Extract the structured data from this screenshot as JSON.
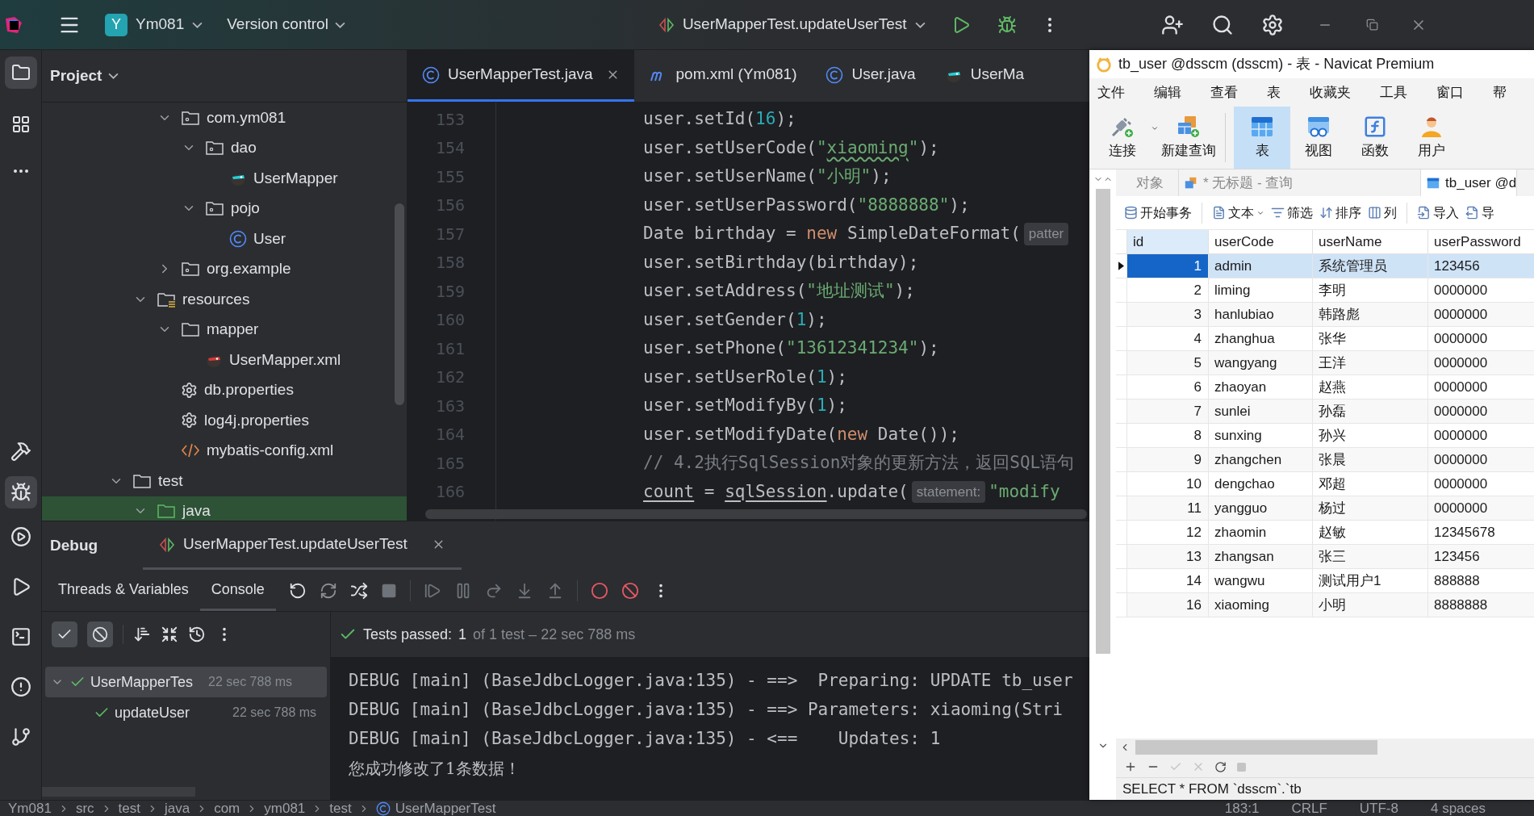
{
  "ide": {
    "topbar": {
      "badge": "Y",
      "project": "Ym081",
      "vcs": "Version control",
      "run_config": "UserMapperTest.updateUserTest"
    },
    "project_panel": {
      "title": "Project",
      "tree": [
        {
          "children": [
            {
              "children": [
                {
                  "label": "com.ym081",
                  "kind": "package",
                  "expanded": true,
                  "selected": false,
                  "children": [
                    {
                      "label": "dao",
                      "kind": "package",
                      "expanded": true,
                      "selected": false,
                      "children": [
                        {
                          "label": "UserMapper",
                          "kind": "mapper",
                          "selected": false
                        }
                      ]
                    },
                    {
                      "label": "pojo",
                      "kind": "package",
                      "expanded": true,
                      "selected": false,
                      "children": [
                        {
                          "label": "User",
                          "kind": "class",
                          "selected": false
                        }
                      ]
                    }
                  ]
                },
                {
                  "label": "org.example",
                  "kind": "package",
                  "expanded": false,
                  "selected": false
                }
              ]
            },
            {
              "label": "resources",
              "kind": "resources",
              "expanded": true,
              "selected": false,
              "children": [
                {
                  "label": "mapper",
                  "kind": "folder",
                  "expanded": true,
                  "selected": false,
                  "children": [
                    {
                      "label": "UserMapper.xml",
                      "kind": "mapper_xml",
                      "selected": false
                    }
                  ]
                },
                {
                  "label": "db.properties",
                  "kind": "properties",
                  "selected": false
                },
                {
                  "label": "log4j.properties",
                  "kind": "properties",
                  "selected": false
                },
                {
                  "label": "mybatis-config.xml",
                  "kind": "xml",
                  "selected": false
                }
              ]
            }
          ]
        },
        {
          "label": "test",
          "kind": "folder",
          "expanded": true,
          "selected": false,
          "children": [
            {
              "label": "java",
              "kind": "test_sources",
              "expanded": true,
              "selected": true
            }
          ]
        }
      ]
    },
    "editor": {
      "tabs": [
        {
          "label": "UserMapperTest.java",
          "kind": "class",
          "selected": true
        },
        {
          "label": "pom.xml (Ym081)",
          "kind": "maven",
          "selected": false
        },
        {
          "label": "User.java",
          "kind": "class",
          "selected": false
        },
        {
          "label": "UserMa",
          "kind": "mapper",
          "selected": false
        }
      ],
      "lines": [
        {
          "number": "153",
          "tokens": [
            {
              "kind": "plain",
              "text": "user.setId("
            },
            {
              "kind": "number",
              "text": "16"
            },
            {
              "kind": "plain",
              "text": ");"
            }
          ]
        },
        {
          "number": "154",
          "tokens": [
            {
              "kind": "plain",
              "text": "user.setUserCode("
            },
            {
              "kind": "string",
              "text": "\""
            },
            {
              "kind": "typo",
              "text": "xiaoming"
            },
            {
              "kind": "string",
              "text": "\""
            },
            {
              "kind": "plain",
              "text": ");"
            }
          ]
        },
        {
          "number": "155",
          "tokens": [
            {
              "kind": "plain",
              "text": "user.setUserName("
            },
            {
              "kind": "string",
              "text": "\"小明\""
            },
            {
              "kind": "plain",
              "text": ");"
            }
          ]
        },
        {
          "number": "156",
          "tokens": [
            {
              "kind": "plain",
              "text": "user.setUserPassword("
            },
            {
              "kind": "string",
              "text": "\"8888888\""
            },
            {
              "kind": "plain",
              "text": ");"
            }
          ]
        },
        {
          "number": "157",
          "tokens": [
            {
              "kind": "plain",
              "text": "Date birthday = "
            },
            {
              "kind": "keyword",
              "text": "new"
            },
            {
              "kind": "plain",
              "text": " SimpleDateFormat("
            },
            {
              "kind": "hint",
              "text": "patter"
            }
          ]
        },
        {
          "number": "158",
          "tokens": [
            {
              "kind": "plain",
              "text": "user.setBirthday(birthday);"
            }
          ]
        },
        {
          "number": "159",
          "tokens": [
            {
              "kind": "plain",
              "text": "user.setAddress("
            },
            {
              "kind": "string",
              "text": "\"地址测试\""
            },
            {
              "kind": "plain",
              "text": ");"
            }
          ]
        },
        {
          "number": "160",
          "tokens": [
            {
              "kind": "plain",
              "text": "user.setGender("
            },
            {
              "kind": "number",
              "text": "1"
            },
            {
              "kind": "plain",
              "text": ");"
            }
          ]
        },
        {
          "number": "161",
          "tokens": [
            {
              "kind": "plain",
              "text": "user.setPhone("
            },
            {
              "kind": "string",
              "text": "\"13612341234\""
            },
            {
              "kind": "plain",
              "text": ");"
            }
          ]
        },
        {
          "number": "162",
          "tokens": [
            {
              "kind": "plain",
              "text": "user.setUserRole("
            },
            {
              "kind": "number",
              "text": "1"
            },
            {
              "kind": "plain",
              "text": ");"
            }
          ]
        },
        {
          "number": "163",
          "tokens": [
            {
              "kind": "plain",
              "text": "user.setModifyBy("
            },
            {
              "kind": "number",
              "text": "1"
            },
            {
              "kind": "plain",
              "text": ");"
            }
          ]
        },
        {
          "number": "164",
          "tokens": [
            {
              "kind": "plain",
              "text": "user.setModifyDate("
            },
            {
              "kind": "keyword",
              "text": "new"
            },
            {
              "kind": "plain",
              "text": " Date());"
            }
          ]
        },
        {
          "number": "165",
          "tokens": [
            {
              "kind": "comment",
              "text": "// 4.2执行SqlSession对象的更新方法，返回SQL语句"
            }
          ]
        },
        {
          "number": "166",
          "tokens": [
            {
              "kind": "underlined",
              "text": "count"
            },
            {
              "kind": "plain",
              "text": " = "
            },
            {
              "kind": "underlined",
              "text": "sqlSession"
            },
            {
              "kind": "plain",
              "text": ".update("
            },
            {
              "kind": "hint",
              "text": "statement:"
            },
            {
              "kind": "string",
              "text": "\"modify"
            }
          ]
        }
      ]
    },
    "debug": {
      "title": "Debug",
      "session_tab": "UserMapperTest.updateUserTest",
      "subtabs": [
        {
          "label": "Threads & Variables",
          "selected": false
        },
        {
          "label": "Console",
          "selected": true
        }
      ],
      "filters": [
        {
          "kind": "passed",
          "on": true
        },
        {
          "kind": "ignored",
          "on": true
        }
      ],
      "tests": [
        {
          "label": "UserMapperTes",
          "time": "22 sec 788 ms",
          "passed": true,
          "selected": true,
          "expanded": true,
          "children": [
            {
              "label": "updateUser",
              "time": "22 sec 788 ms",
              "passed": true,
              "selected": false
            }
          ]
        }
      ],
      "result": {
        "status": "Tests passed:",
        "count": "1",
        "detail": "of 1 test – 22 sec 788 ms"
      },
      "console": [
        {
          "kind": "log",
          "text": "DEBUG [main] (BaseJdbcLogger.java:135) - ==>  Preparing: UPDATE tb_user"
        },
        {
          "kind": "log",
          "text": "DEBUG [main] (BaseJdbcLogger.java:135) - ==> Parameters: xiaoming(Stri"
        },
        {
          "kind": "log",
          "text": "DEBUG [main] (BaseJdbcLogger.java:135) - <==    Updates: 1"
        },
        {
          "kind": "message",
          "text": "您成功修改了1条数据！"
        }
      ]
    },
    "status_bar": {
      "breadcrumbs": [
        "Ym081",
        "src",
        "test",
        "java",
        "com",
        "ym081",
        "test",
        "UserMapperTest"
      ],
      "info": [
        "183:1",
        "CRLF",
        "UTF-8",
        "4 spaces"
      ]
    }
  },
  "navicat": {
    "title": "tb_user @dsscm (dsscm) - 表 - Navicat Premium",
    "menu": [
      "文件",
      "编辑",
      "查看",
      "表",
      "收藏夹",
      "工具",
      "窗口",
      "帮"
    ],
    "toolbar": [
      {
        "label": "连接",
        "kind": "connect",
        "selected": false
      },
      {
        "label": "新建查询",
        "kind": "query",
        "selected": false
      },
      {
        "label": "表",
        "kind": "table",
        "selected": true
      },
      {
        "label": "视图",
        "kind": "view",
        "selected": false
      },
      {
        "label": "函数",
        "kind": "function",
        "selected": false
      },
      {
        "label": "用户",
        "kind": "user",
        "selected": false
      }
    ],
    "tabs": [
      {
        "label": "对象",
        "kind": "objects",
        "selected": false
      },
      {
        "label": "* 无标题 - 查询",
        "kind": "query",
        "selected": false
      },
      {
        "label": "tb_user @d",
        "kind": "table",
        "selected": true
      }
    ],
    "grid_toolbar": [
      {
        "label": "开始事务",
        "kind": "transaction"
      },
      {
        "label": "文本",
        "kind": "text"
      },
      {
        "label": "筛选",
        "kind": "filter"
      },
      {
        "label": "排序",
        "kind": "sort"
      },
      {
        "label": "列",
        "kind": "columns"
      },
      {
        "label": "导入",
        "kind": "import"
      },
      {
        "label": "导",
        "kind": "export"
      }
    ],
    "table": {
      "columns": [
        "id",
        "userCode",
        "userName",
        "userPassword"
      ],
      "rows": [
        {
          "cells": [
            "1",
            "admin",
            "系统管理员",
            "123456"
          ],
          "selected": true
        },
        {
          "cells": [
            "2",
            "liming",
            "李明",
            "0000000"
          ],
          "selected": false
        },
        {
          "cells": [
            "3",
            "hanlubiao",
            "韩路彪",
            "0000000"
          ],
          "selected": false
        },
        {
          "cells": [
            "4",
            "zhanghua",
            "张华",
            "0000000"
          ],
          "selected": false
        },
        {
          "cells": [
            "5",
            "wangyang",
            "王洋",
            "0000000"
          ],
          "selected": false
        },
        {
          "cells": [
            "6",
            "zhaoyan",
            "赵燕",
            "0000000"
          ],
          "selected": false
        },
        {
          "cells": [
            "7",
            "sunlei",
            "孙磊",
            "0000000"
          ],
          "selected": false
        },
        {
          "cells": [
            "8",
            "sunxing",
            "孙兴",
            "0000000"
          ],
          "selected": false
        },
        {
          "cells": [
            "9",
            "zhangchen",
            "张晨",
            "0000000"
          ],
          "selected": false
        },
        {
          "cells": [
            "10",
            "dengchao",
            "邓超",
            "0000000"
          ],
          "selected": false
        },
        {
          "cells": [
            "11",
            "yangguo",
            "杨过",
            "0000000"
          ],
          "selected": false
        },
        {
          "cells": [
            "12",
            "zhaomin",
            "赵敏",
            "12345678"
          ],
          "selected": false
        },
        {
          "cells": [
            "13",
            "zhangsan",
            "张三",
            "123456"
          ],
          "selected": false
        },
        {
          "cells": [
            "14",
            "wangwu",
            "测试用户1",
            "888888"
          ],
          "selected": false
        },
        {
          "cells": [
            "16",
            "xiaoming",
            "小明",
            "8888888"
          ],
          "selected": false
        }
      ]
    },
    "sql": "SELECT * FROM `dsscm`.`tb"
  }
}
